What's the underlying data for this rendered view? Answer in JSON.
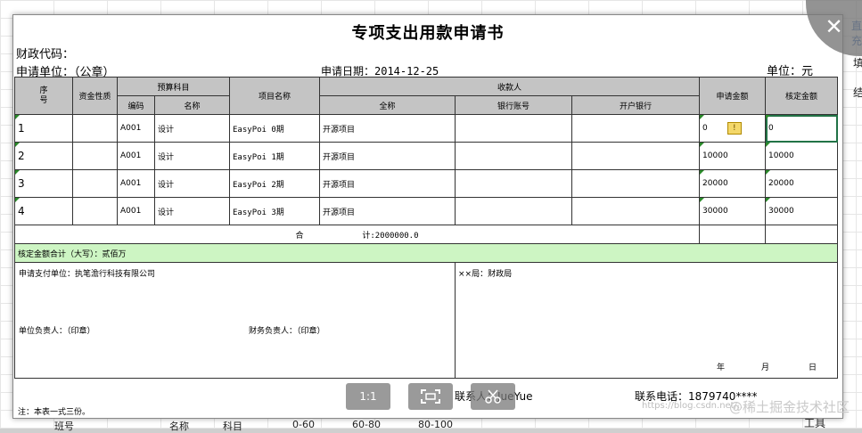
{
  "doc": {
    "title": "专项支出用款申请书",
    "finance_code_label": "财政代码：",
    "applicant_label": "申请单位：（公章）",
    "apply_date": "申请日期：2014-12-25",
    "unit": "单位：元"
  },
  "headers": {
    "seq": "序\n号",
    "fund_nature": "资金性质",
    "budget_subject": "预算科目",
    "code": "编码",
    "name": "名称",
    "project_name": "项目名称",
    "payee": "收款人",
    "fullname": "全称",
    "bank_account": "银行账号",
    "bank": "开户银行",
    "apply_amount": "申请金额",
    "approved_amount": "核定金额"
  },
  "rows": [
    {
      "seq": "1",
      "code": "A001",
      "name": "设计",
      "project": "EasyPoi 0期",
      "payee": "开源项目",
      "apply": "0",
      "approved": "0"
    },
    {
      "seq": "2",
      "code": "A001",
      "name": "设计",
      "project": "EasyPoi 1期",
      "payee": "开源项目",
      "apply": "10000",
      "approved": "10000"
    },
    {
      "seq": "3",
      "code": "A001",
      "name": "设计",
      "project": "EasyPoi 2期",
      "payee": "开源项目",
      "apply": "20000",
      "approved": "20000"
    },
    {
      "seq": "4",
      "code": "A001",
      "name": "设计",
      "project": "EasyPoi 3期",
      "payee": "开源项目",
      "apply": "30000",
      "approved": "30000"
    }
  ],
  "total": {
    "label": "合",
    "value": "计:2000000.0"
  },
  "approved_total": "核定金额合计（大写）：贰佰万",
  "pay_unit": "申请支付单位：执笔澹行科技有限公司",
  "bureau": "××局：财政局",
  "unit_head": "单位负责人：（印章）",
  "finance_head": "财务负责人：（印章）",
  "date_year": "年",
  "date_month": "月",
  "date_day": "日",
  "contact_person": "联系人：JueYue",
  "contact_phone": "联系电话：1879740****",
  "note": "注：本表一式三份。",
  "viewer": {
    "zoom_label": "1:1",
    "close_glyph": "✕"
  },
  "background": {
    "bottom_cells": [
      "班号",
      "名称",
      "科目",
      "0-60",
      "60-80",
      "80-100"
    ],
    "right_tab_1": "工具",
    "right_top": "直充",
    "right_a": "填",
    "right_b": "结"
  },
  "watermark": "@稀土掘金技术社区",
  "watermark_url": "https://blog.csdn.net/..."
}
